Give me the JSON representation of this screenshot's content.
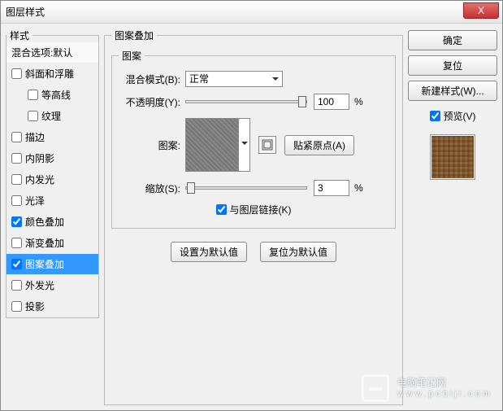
{
  "titlebar": {
    "title": "图层样式",
    "close": "X"
  },
  "left": {
    "legend": "样式",
    "blend_options": "混合选项:默认",
    "items": [
      {
        "label": "斜面和浮雕",
        "checked": false,
        "indent": false
      },
      {
        "label": "等高线",
        "checked": false,
        "indent": true
      },
      {
        "label": "纹理",
        "checked": false,
        "indent": true
      },
      {
        "label": "描边",
        "checked": false,
        "indent": false
      },
      {
        "label": "内阴影",
        "checked": false,
        "indent": false
      },
      {
        "label": "内发光",
        "checked": false,
        "indent": false
      },
      {
        "label": "光泽",
        "checked": false,
        "indent": false
      },
      {
        "label": "颜色叠加",
        "checked": true,
        "indent": false
      },
      {
        "label": "渐变叠加",
        "checked": false,
        "indent": false
      },
      {
        "label": "图案叠加",
        "checked": true,
        "indent": false,
        "selected": true
      },
      {
        "label": "外发光",
        "checked": false,
        "indent": false
      },
      {
        "label": "投影",
        "checked": false,
        "indent": false
      }
    ]
  },
  "center": {
    "legend": "图案叠加",
    "inner_legend": "图案",
    "blend_mode_label": "混合模式(B):",
    "blend_mode_value": "正常",
    "opacity_label": "不透明度(Y):",
    "opacity_value": "100",
    "opacity_unit": "%",
    "pattern_label": "图案:",
    "snap_button": "贴紧原点(A)",
    "scale_label": "缩放(S):",
    "scale_value": "3",
    "scale_unit": "%",
    "link_label": "与图层链接(K)",
    "set_default": "设置为默认值",
    "reset_default": "复位为默认值"
  },
  "right": {
    "ok": "确定",
    "reset": "复位",
    "new_style": "新建样式(W)...",
    "preview_label": "预览(V)"
  },
  "watermark": {
    "a": "电脑笔记网",
    "b": "www.pcbiji.com"
  }
}
